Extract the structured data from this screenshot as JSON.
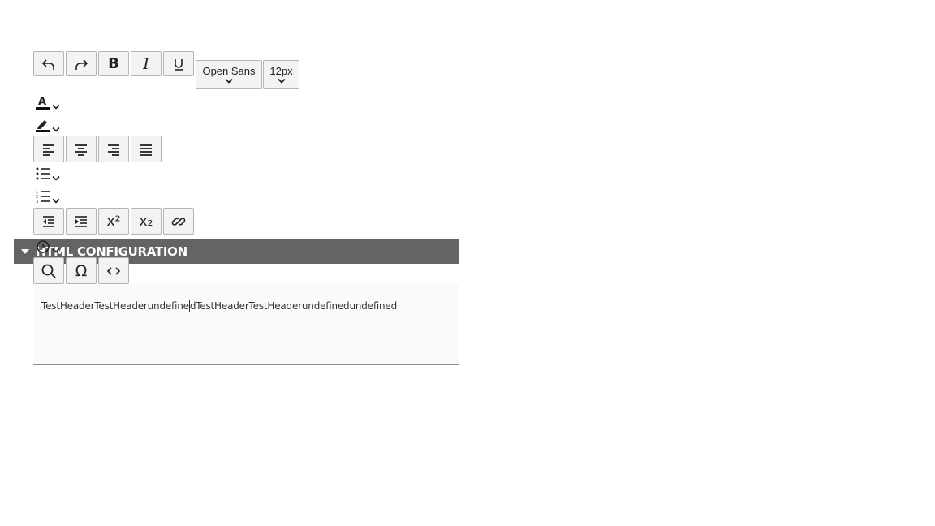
{
  "toolbar": {
    "row1": [
      {
        "name": "undo-button",
        "icon": "undo-icon"
      },
      {
        "name": "redo-button",
        "icon": "redo-icon"
      },
      {
        "name": "bold-button",
        "icon": "bold-icon",
        "label": "B"
      },
      {
        "name": "italic-button",
        "icon": "italic-icon",
        "label": "I"
      },
      {
        "name": "underline-button",
        "icon": "underline-icon"
      }
    ],
    "font_family": "Open Sans",
    "font_size": "12px",
    "text_color_icon": "text-color-icon",
    "highlight_icon": "highlight-icon",
    "align": [
      "align-left-icon",
      "align-center-icon",
      "align-right-icon",
      "justify-icon"
    ],
    "bullet_list_icon": "bullet-list-icon",
    "numbered_list_icon": "numbered-list-icon",
    "row3": [
      "outdent-icon",
      "indent-icon",
      "superscript-icon",
      "subscript-icon",
      "link-icon"
    ],
    "superscript_label": "x²",
    "subscript_label": "x₂",
    "history_icon": "clock-icon",
    "row4": [
      "search-icon",
      "special-char-icon",
      "source-code-icon"
    ],
    "omega_label": "Ω"
  },
  "section": {
    "title": "HTML CONFIGURATION"
  },
  "editor": {
    "text_before_cursor": "TestHeaderTestHeaderundefine",
    "text_after_cursor": "dTestHeaderTestHeaderundefinedundefined"
  },
  "colors": {
    "section_bar": "#646464",
    "button_bg": "#f3f3f3",
    "button_border": "#b5b5b5",
    "editor_bg": "#fafafa"
  }
}
